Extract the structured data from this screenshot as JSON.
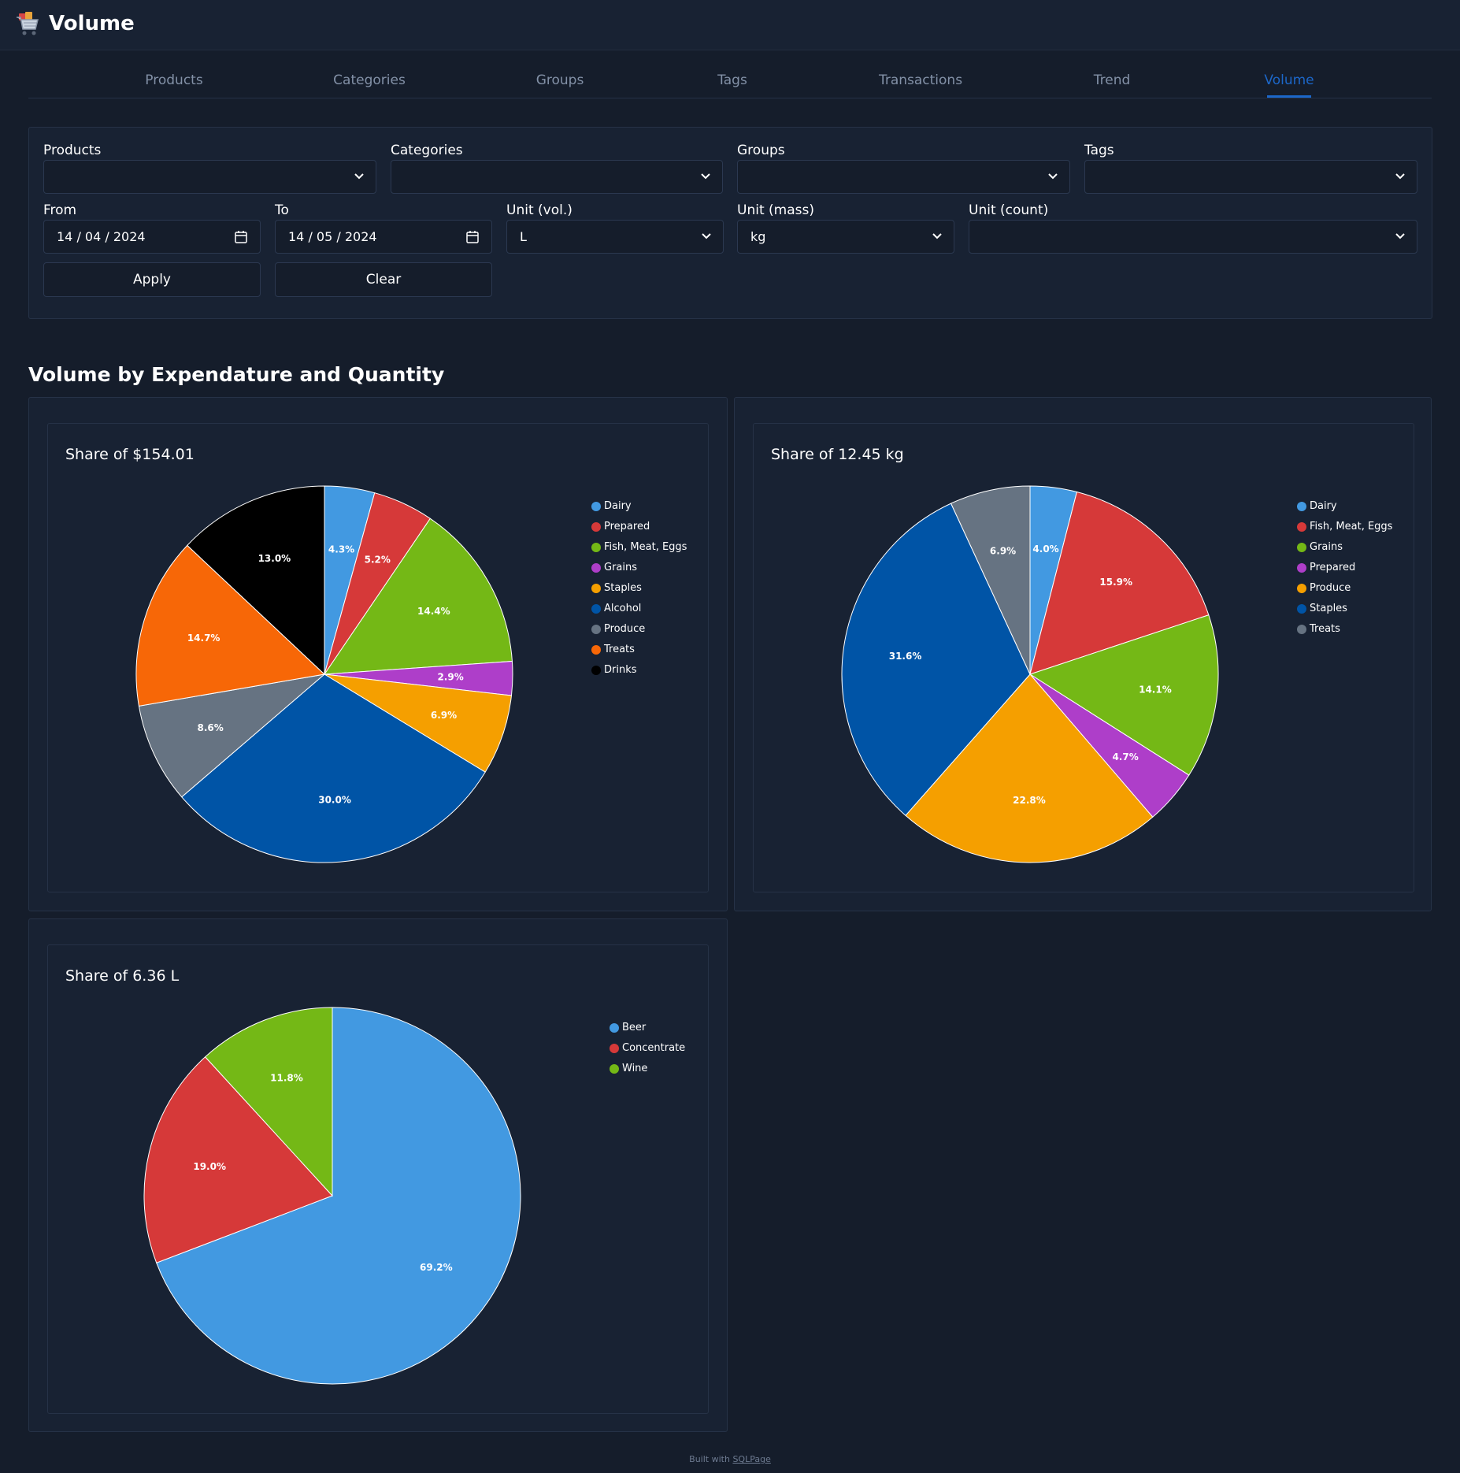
{
  "app": {
    "title": "Volume"
  },
  "tabs": [
    {
      "label": "Products",
      "active": false
    },
    {
      "label": "Categories",
      "active": false
    },
    {
      "label": "Groups",
      "active": false
    },
    {
      "label": "Tags",
      "active": false
    },
    {
      "label": "Transactions",
      "active": false
    },
    {
      "label": "Trend",
      "active": false
    },
    {
      "label": "Volume",
      "active": true
    }
  ],
  "filters": {
    "products_label": "Products",
    "products_value": "",
    "categories_label": "Categories",
    "categories_value": "",
    "groups_label": "Groups",
    "groups_value": "",
    "tags_label": "Tags",
    "tags_value": "",
    "from_label": "From",
    "from_value": "14 / 04 / 2024",
    "to_label": "To",
    "to_value": "14 / 05 / 2024",
    "unit_vol_label": "Unit (vol.)",
    "unit_vol_value": "L",
    "unit_mass_label": "Unit (mass)",
    "unit_mass_value": "kg",
    "unit_count_label": "Unit (count)",
    "unit_count_value": "",
    "apply_label": "Apply",
    "clear_label": "Clear"
  },
  "section": {
    "title": "Volume by Expendature and Quantity"
  },
  "colors": {
    "accent": "#1c67c9",
    "background": "#151d2b",
    "card": "#182233"
  },
  "footer": {
    "prefix": "Built with",
    "link_text": "SQLPage"
  },
  "chart_data": [
    {
      "type": "pie",
      "title": "Share of $154.01",
      "slices": [
        {
          "name": "Dairy",
          "value": 4.3,
          "label": "4.3%",
          "color": "#4299e1"
        },
        {
          "name": "Prepared",
          "value": 5.2,
          "label": "5.2%",
          "color": "#d63939"
        },
        {
          "name": "Fish, Meat, Eggs",
          "value": 14.4,
          "label": "14.4%",
          "color": "#74b816"
        },
        {
          "name": "Grains",
          "value": 2.9,
          "label": "2.9%",
          "color": "#ae3ec9"
        },
        {
          "name": "Staples",
          "value": 6.9,
          "label": "6.9%",
          "color": "#f59f00"
        },
        {
          "name": "Alcohol",
          "value": 30.0,
          "label": "30.0%",
          "color": "#0054a6"
        },
        {
          "name": "Produce",
          "value": 8.6,
          "label": "8.6%",
          "color": "#667382"
        },
        {
          "name": "Treats",
          "value": 14.7,
          "label": "14.7%",
          "color": "#f76707"
        },
        {
          "name": "Drinks",
          "value": 13.0,
          "label": "13.0%",
          "color": "#000000"
        }
      ],
      "legend_position": "right"
    },
    {
      "type": "pie",
      "title": "Share of 12.45 kg",
      "slices": [
        {
          "name": "Dairy",
          "value": 4.0,
          "label": "4.0%",
          "color": "#4299e1"
        },
        {
          "name": "Fish, Meat, Eggs",
          "value": 15.9,
          "label": "15.9%",
          "color": "#d63939"
        },
        {
          "name": "Grains",
          "value": 14.1,
          "label": "14.1%",
          "color": "#74b816"
        },
        {
          "name": "Prepared",
          "value": 4.7,
          "label": "4.7%",
          "color": "#ae3ec9"
        },
        {
          "name": "Produce",
          "value": 22.8,
          "label": "22.8%",
          "color": "#f59f00"
        },
        {
          "name": "Staples",
          "value": 31.6,
          "label": "31.6%",
          "color": "#0054a6"
        },
        {
          "name": "Treats",
          "value": 6.9,
          "label": "6.9%",
          "color": "#667382"
        }
      ],
      "legend_position": "right"
    },
    {
      "type": "pie",
      "title": "Share of 6.36 L",
      "slices": [
        {
          "name": "Beer",
          "value": 69.2,
          "label": "69.2%",
          "color": "#4299e1"
        },
        {
          "name": "Concentrate",
          "value": 19.0,
          "label": "19.0%",
          "color": "#d63939"
        },
        {
          "name": "Wine",
          "value": 11.8,
          "label": "11.8%",
          "color": "#74b816"
        }
      ],
      "legend_position": "right"
    }
  ]
}
